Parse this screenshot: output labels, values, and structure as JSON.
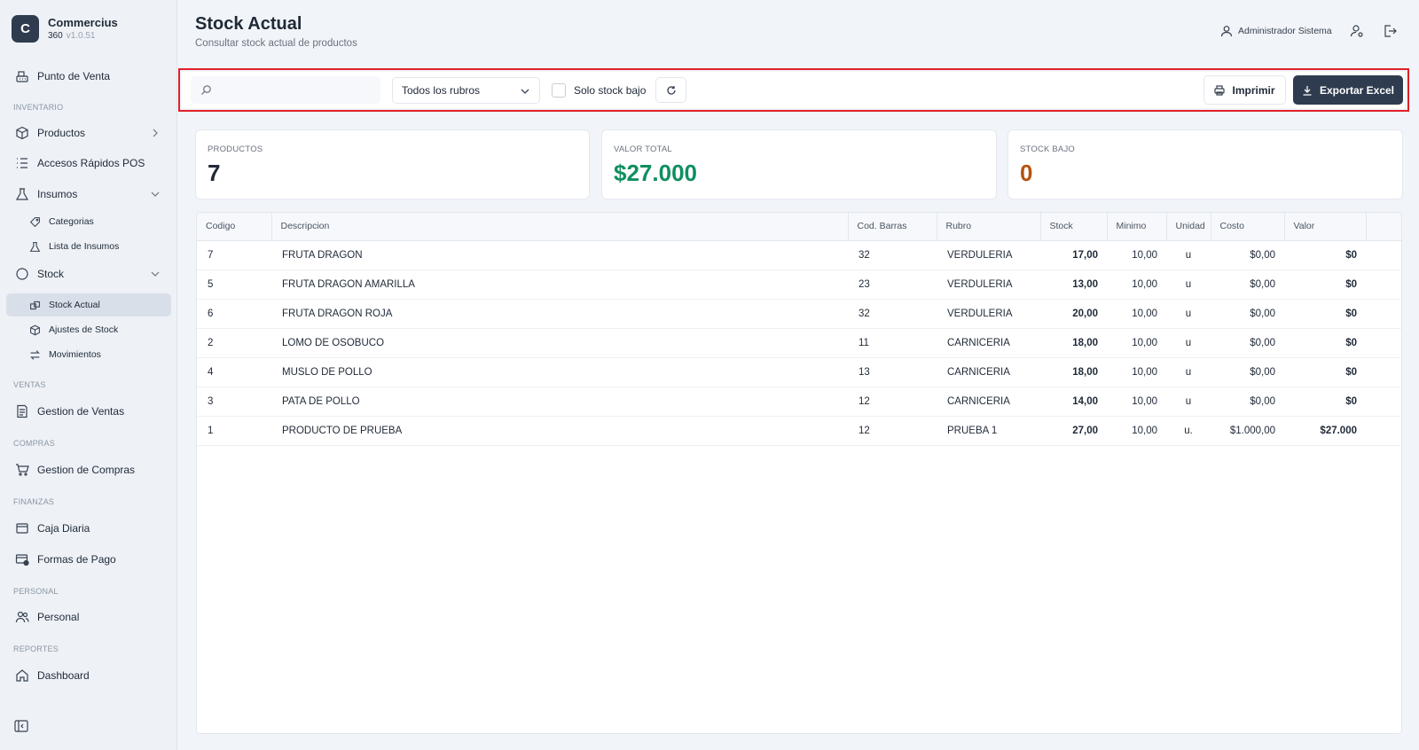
{
  "brand": {
    "logo_letter": "C",
    "name": "Commercius",
    "edition": "360",
    "version": "v1.0.51"
  },
  "sidebar": {
    "punto_venta": "Punto de Venta",
    "sections": {
      "inventario": "INVENTARIO",
      "ventas": "VENTAS",
      "compras": "COMPRAS",
      "finanzas": "FINANZAS",
      "personal": "PERSONAL",
      "reportes": "REPORTES"
    },
    "productos": "Productos",
    "accesos": "Accesos Rápidos POS",
    "insumos": "Insumos",
    "categorias": "Categorias",
    "lista_insumos": "Lista de Insumos",
    "stock": "Stock",
    "stock_actual": "Stock Actual",
    "ajustes": "Ajustes de Stock",
    "movimientos": "Movimientos",
    "gestion_ventas": "Gestion de Ventas",
    "gestion_compras": "Gestion de Compras",
    "caja_diaria": "Caja Diaria",
    "formas_pago": "Formas de Pago",
    "personal": "Personal",
    "dashboard": "Dashboard"
  },
  "header": {
    "title": "Stock Actual",
    "subtitle": "Consultar stock actual de productos",
    "user": "Administrador Sistema"
  },
  "toolbar": {
    "search_value": "",
    "rubro_selected": "Todos los rubros",
    "low_stock_label": "Solo stock bajo",
    "low_stock_checked": false,
    "print_label": "Imprimir",
    "export_label": "Exportar Excel"
  },
  "stats": {
    "productos_label": "PRODUCTOS",
    "productos_value": "7",
    "valor_label": "VALOR TOTAL",
    "valor_value": "$27.000",
    "bajo_label": "STOCK BAJO",
    "bajo_value": "0"
  },
  "colors": {
    "accent": "#2f3c4f",
    "valor": "#0f8f5f",
    "bajo": "#b5530f",
    "highlight_frame": "#e0202a"
  },
  "table": {
    "columns": {
      "codigo": "Codigo",
      "descripcion": "Descripcion",
      "barras": "Cod. Barras",
      "rubro": "Rubro",
      "stock": "Stock",
      "minimo": "Minimo",
      "unidad": "Unidad",
      "costo": "Costo",
      "valor": "Valor"
    },
    "rows": [
      {
        "codigo": "7",
        "descripcion": "FRUTA DRAGON",
        "barras": "32",
        "rubro": "VERDULERIA",
        "stock": "17,00",
        "minimo": "10,00",
        "unidad": "u",
        "costo": "$0,00",
        "valor": "$0"
      },
      {
        "codigo": "5",
        "descripcion": "FRUTA DRAGON AMARILLA",
        "barras": "23",
        "rubro": "VERDULERIA",
        "stock": "13,00",
        "minimo": "10,00",
        "unidad": "u",
        "costo": "$0,00",
        "valor": "$0"
      },
      {
        "codigo": "6",
        "descripcion": "FRUTA DRAGON ROJA",
        "barras": "32",
        "rubro": "VERDULERIA",
        "stock": "20,00",
        "minimo": "10,00",
        "unidad": "u",
        "costo": "$0,00",
        "valor": "$0"
      },
      {
        "codigo": "2",
        "descripcion": "LOMO DE OSOBUCO",
        "barras": "11",
        "rubro": "CARNICERIA",
        "stock": "18,00",
        "minimo": "10,00",
        "unidad": "u",
        "costo": "$0,00",
        "valor": "$0"
      },
      {
        "codigo": "4",
        "descripcion": "MUSLO DE POLLO",
        "barras": "13",
        "rubro": "CARNICERIA",
        "stock": "18,00",
        "minimo": "10,00",
        "unidad": "u",
        "costo": "$0,00",
        "valor": "$0"
      },
      {
        "codigo": "3",
        "descripcion": "PATA DE POLLO",
        "barras": "12",
        "rubro": "CARNICERIA",
        "stock": "14,00",
        "minimo": "10,00",
        "unidad": "u",
        "costo": "$0,00",
        "valor": "$0"
      },
      {
        "codigo": "1",
        "descripcion": "PRODUCTO DE PRUEBA",
        "barras": "12",
        "rubro": "PRUEBA 1",
        "stock": "27,00",
        "minimo": "10,00",
        "unidad": "u.",
        "costo": "$1.000,00",
        "valor": "$27.000"
      }
    ]
  }
}
